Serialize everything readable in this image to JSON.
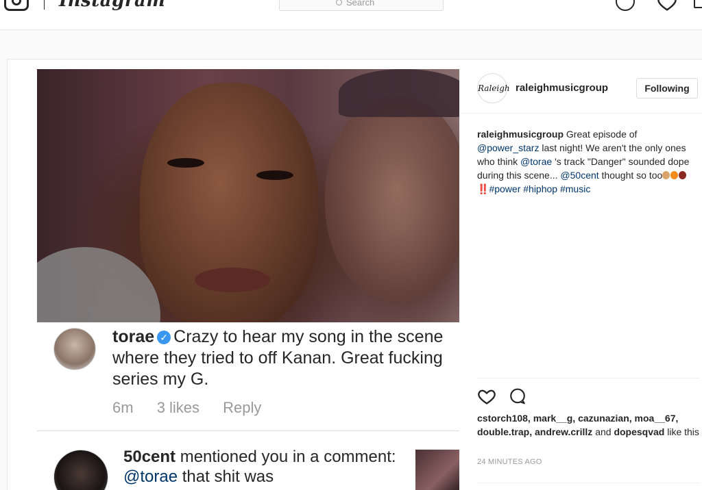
{
  "nav": {
    "wordmark": "Instagram",
    "search_placeholder": "Search"
  },
  "post": {
    "comment": {
      "username": "torae",
      "text": "Crazy to hear my song in the scene where they tried to off Kanan. Great fucking series my G.",
      "time": "6m",
      "likes": "3 likes",
      "reply": "Reply"
    },
    "notification": {
      "username": "50cent",
      "text_before": "mentioned you in a comment:",
      "mention": "@torae",
      "text_after": "that shit was"
    }
  },
  "sidebar": {
    "username": "raleighmusicgroup",
    "logo_text": "Raleigh",
    "follow_button": "Following",
    "caption": {
      "username": "raleighmusicgroup",
      "part1": "Great episode of",
      "mention1": "@power_starz",
      "part2": "last night! We aren't the only ones who think",
      "mention2": "@torae",
      "part3": "'s track \"Danger\" sounded dope during this scene...",
      "mention3": "@50cent",
      "part4": "thought so too",
      "part5": "‼️",
      "tag1": "#power",
      "tag2": "#hiphop",
      "tag3": "#music"
    },
    "likes": {
      "names": "cstorch108, mark__g, cazunazian, moa__67, double.trap, andrew.crillz",
      "and_word": "and",
      "last_name": "dopesqvad",
      "suffix": "like this"
    },
    "timestamp": "24 MINUTES AGO"
  },
  "colors": {
    "link": "#003569",
    "verified": "#3897f0",
    "muted": "#999999",
    "border": "#dbdbdb"
  },
  "icons": [
    "instagram-camera-icon",
    "search-icon",
    "explore-compass-icon",
    "heart-icon",
    "profile-icon",
    "verified-badge-icon",
    "comment-icon"
  ]
}
